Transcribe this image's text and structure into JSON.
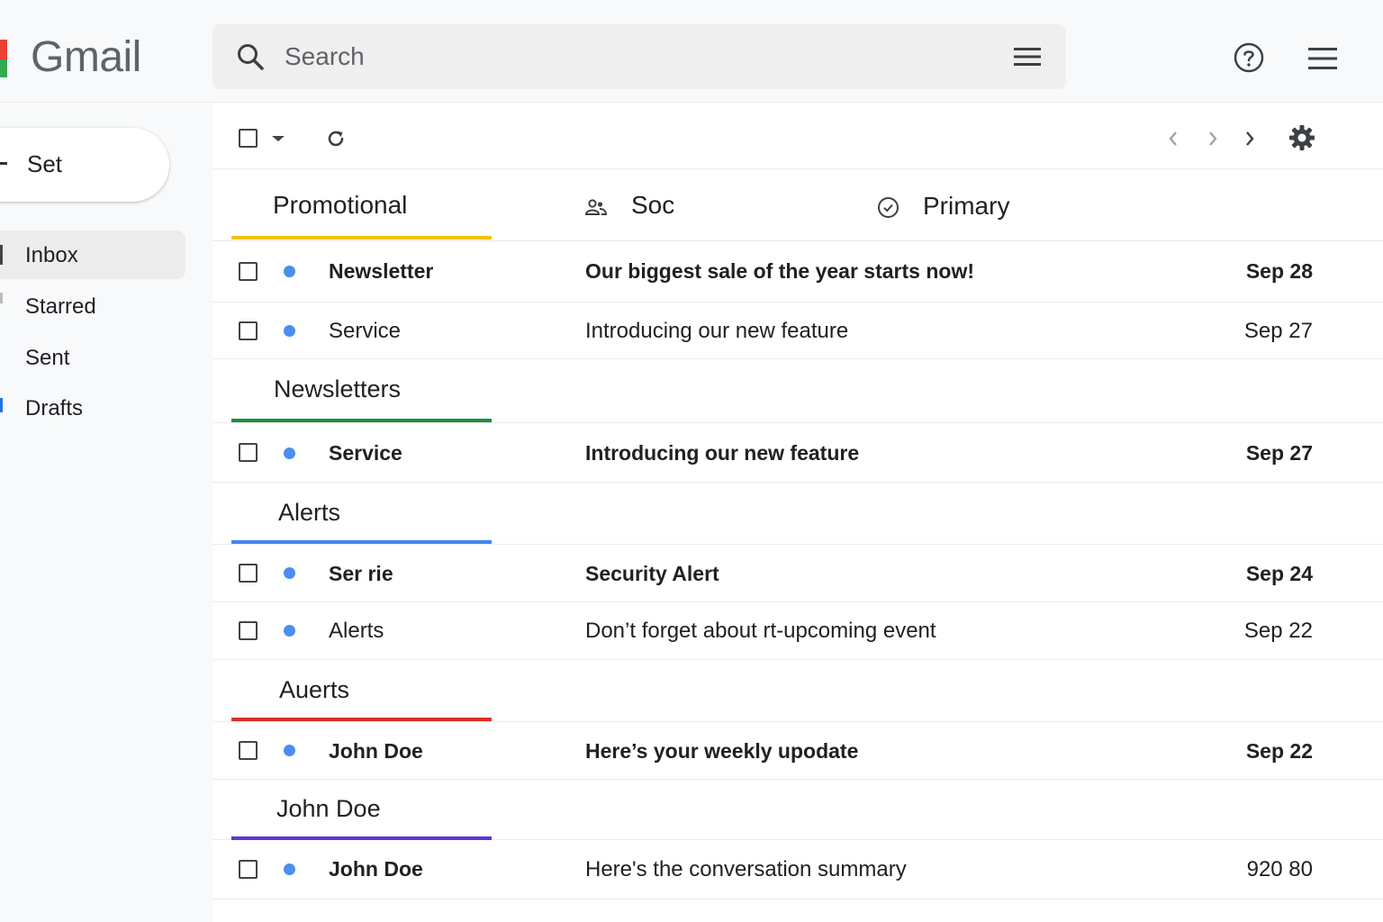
{
  "app": {
    "title": "Gmail"
  },
  "search": {
    "placeholder": "Search"
  },
  "sidebar": {
    "compose_label": "Set",
    "items": [
      {
        "label": "Inbox",
        "active": true
      },
      {
        "label": "Starred"
      },
      {
        "label": "Sent"
      },
      {
        "label": "Drafts"
      }
    ]
  },
  "tabs": [
    {
      "label": "Promotional",
      "color": "#f4c20d"
    },
    {
      "label": "Soc"
    },
    {
      "label": "Primary"
    }
  ],
  "sections": [
    {
      "label": "Newsletters",
      "color": "#1e8e3e"
    },
    {
      "label": "Alerts",
      "color": "#4285f4"
    },
    {
      "label": "Auerts",
      "color": "#d93025"
    },
    {
      "label": "John Doe",
      "color": "#5e35d6"
    }
  ],
  "rows": [
    {
      "sender": "Newsletter",
      "subject": "Our biggest sale of the year starts now!",
      "date": "Sep 28"
    },
    {
      "sender": "Service",
      "subject": "Introducing our new feature",
      "date": "Sep 27"
    },
    {
      "sender": "Service",
      "subject": "Introducing our new feature",
      "date": "Sep 27"
    },
    {
      "sender": "Ser rie",
      "subject": "Security Alert",
      "date": "Sep 24"
    },
    {
      "sender": "Alerts",
      "subject": "Don’t forget about rt-upcoming event",
      "date": "Sep 22"
    },
    {
      "sender": "John Doe",
      "subject": "Here’s your weekly upodate",
      "date": "Sep 22"
    },
    {
      "sender": "John Doe",
      "subject": "Here's the conversation summary",
      "date": "920 80"
    }
  ]
}
